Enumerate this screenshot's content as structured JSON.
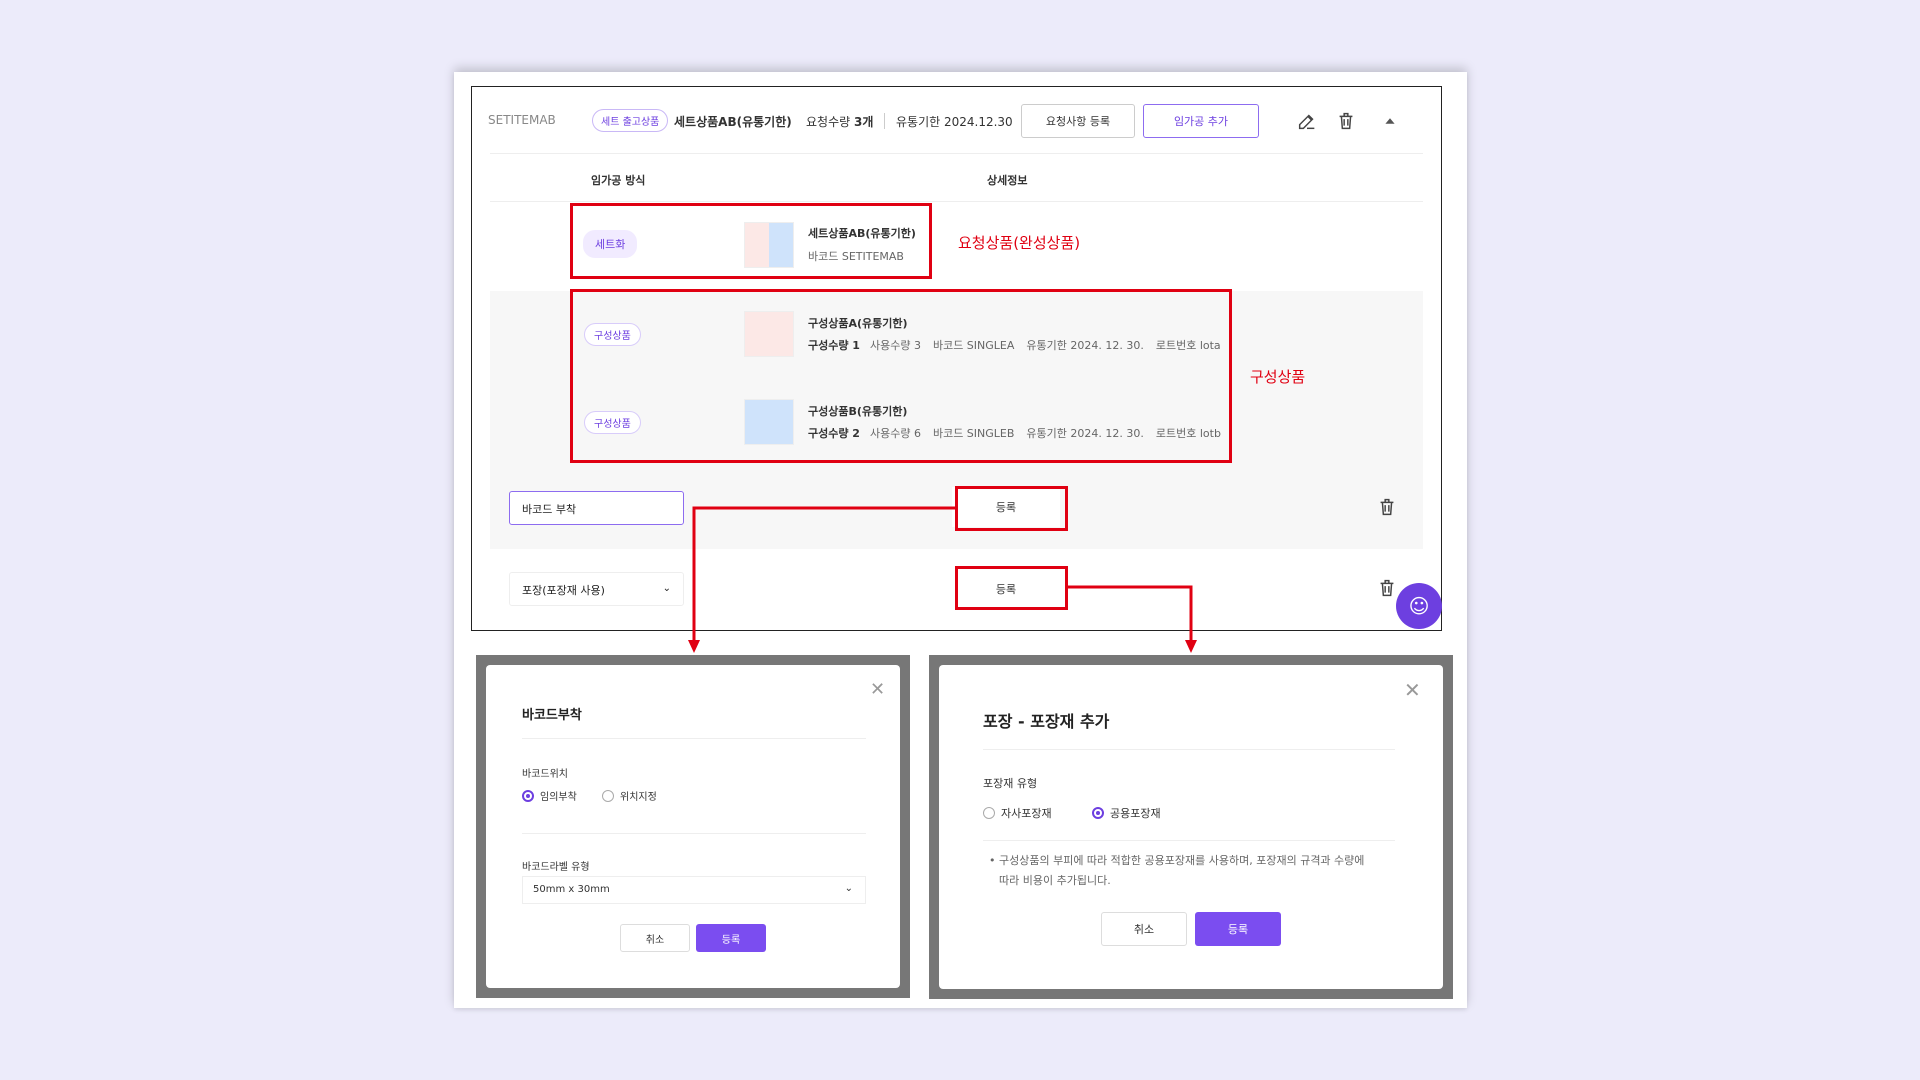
{
  "header": {
    "code": "SETITEMAB",
    "badge": "세트 출고상품",
    "product_name": "세트상품AB(유통기한)",
    "qty_label": "요청수량",
    "qty_value": "3개",
    "expiry": "유통기한 2024.12.30",
    "btn_request": "요청사항 등록",
    "btn_add": "임가공 추가"
  },
  "columns": {
    "method": "임가공 방식",
    "detail": "상세정보"
  },
  "set_row": {
    "chip": "세트화",
    "name": "세트상품AB(유통기한)",
    "barcode": "바코드 SETITEMAB",
    "annotation": "요청상품(완성상품)"
  },
  "components": [
    {
      "chip": "구성상품",
      "name": "구성상품A(유통기한)",
      "comp_qty": "구성수량 1",
      "use_qty": "사용수량 3",
      "barcode": "바코드 SINGLEA",
      "expiry": "유통기한 2024. 12. 30.",
      "lot": "로트번호 lota"
    },
    {
      "chip": "구성상품",
      "name": "구성상품B(유통기한)",
      "comp_qty": "구성수량 2",
      "use_qty": "사용수량 6",
      "barcode": "바코드 SINGLEB",
      "expiry": "유통기한 2024. 12. 30.",
      "lot": "로트번호 lotb"
    }
  ],
  "components_annotation": "구성상품",
  "process_rows": [
    {
      "select": "바코드 부착",
      "button": "등록"
    },
    {
      "select": "포장(포장재 사용)",
      "button": "등록"
    }
  ],
  "modal_barcode": {
    "title": "바코드부착",
    "position_label": "바코드위치",
    "options": [
      "임의부착",
      "위치지정"
    ],
    "selected": 0,
    "label_type_label": "바코드라벨 유형",
    "label_type_value": "50mm x 30mm",
    "cancel": "취소",
    "submit": "등록"
  },
  "modal_packaging": {
    "title": "포장 - 포장재 추가",
    "type_label": "포장재 유형",
    "options": [
      "자사포장재",
      "공용포장재"
    ],
    "selected": 1,
    "note_line1": "• 구성상품의 부피에 따라 적합한 공용포장재를 사용하며, 포장재의 규격과 수량에",
    "note_line2": "따라 비용이 추가됩니다.",
    "cancel": "취소",
    "submit": "등록"
  },
  "colors": {
    "accent": "#6d3fe0",
    "annotation": "#e00012",
    "background": "#ecebfa"
  }
}
